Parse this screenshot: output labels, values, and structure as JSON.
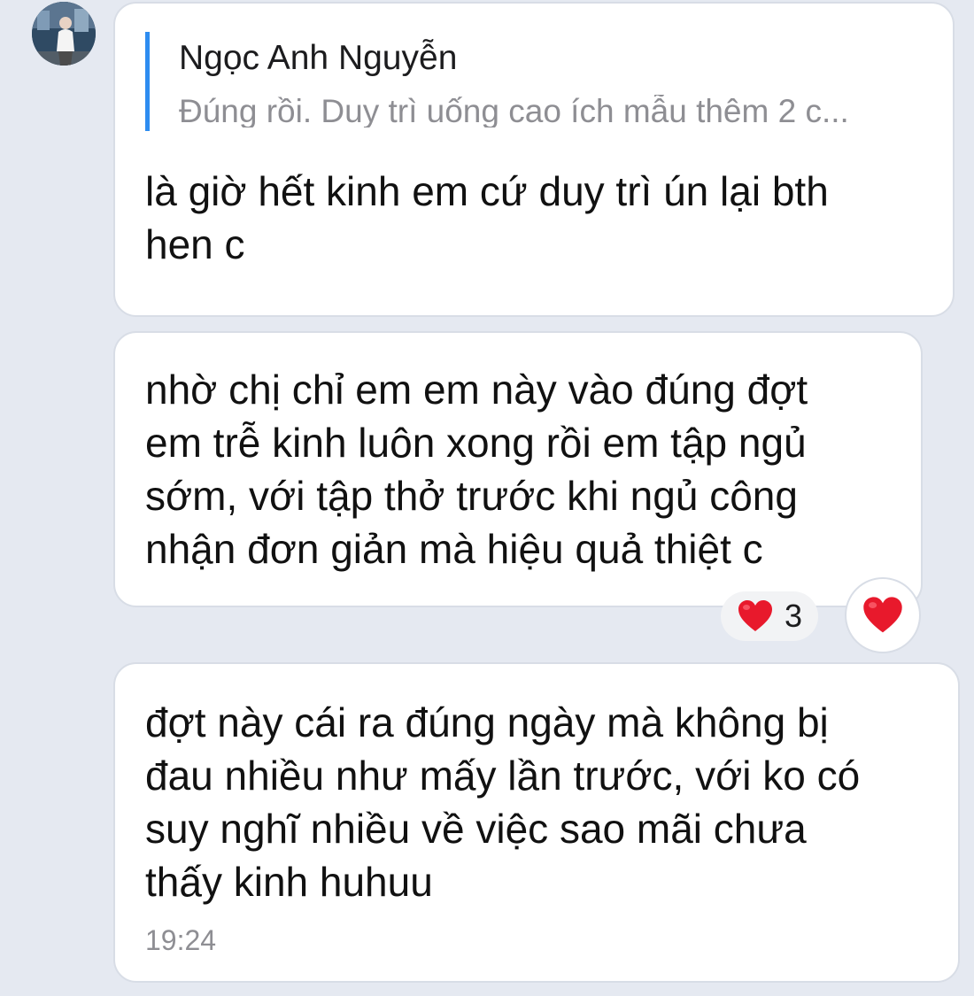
{
  "chat": {
    "sender_avatar_icon": "user-avatar-photo",
    "messages": [
      {
        "reply_to": {
          "name": "Ngọc Anh Nguyễn",
          "snippet": "Đúng rồi. Duy trì uống cao ích mẫu thêm 2 c..."
        },
        "lines": [
          "là giờ hết kinh em cứ duy trì ún lại bth",
          "hen c"
        ]
      },
      {
        "lines": [
          "nhờ chị chỉ em em này vào đúng đợt",
          "em trễ kinh luôn xong rồi em tập ngủ",
          "sớm, với tập thở trước khi ngủ công",
          "nhận đơn giản mà hiệu quả thiệt c"
        ],
        "reaction": {
          "icon": "heart-icon",
          "count": "3"
        }
      },
      {
        "lines": [
          "đợt này cái ra đúng ngày mà không bị",
          "đau nhiều như mấy lần trước, với ko có",
          "suy nghĩ nhiều về việc sao mãi chưa",
          "thấy kinh huhuu"
        ],
        "time": "19:24"
      }
    ],
    "react_button_icon": "heart-icon",
    "colors": {
      "background": "#e5e9f1",
      "bubble": "#ffffff",
      "reply_bar": "#2d8cf0",
      "heart": "#e8192c"
    }
  }
}
